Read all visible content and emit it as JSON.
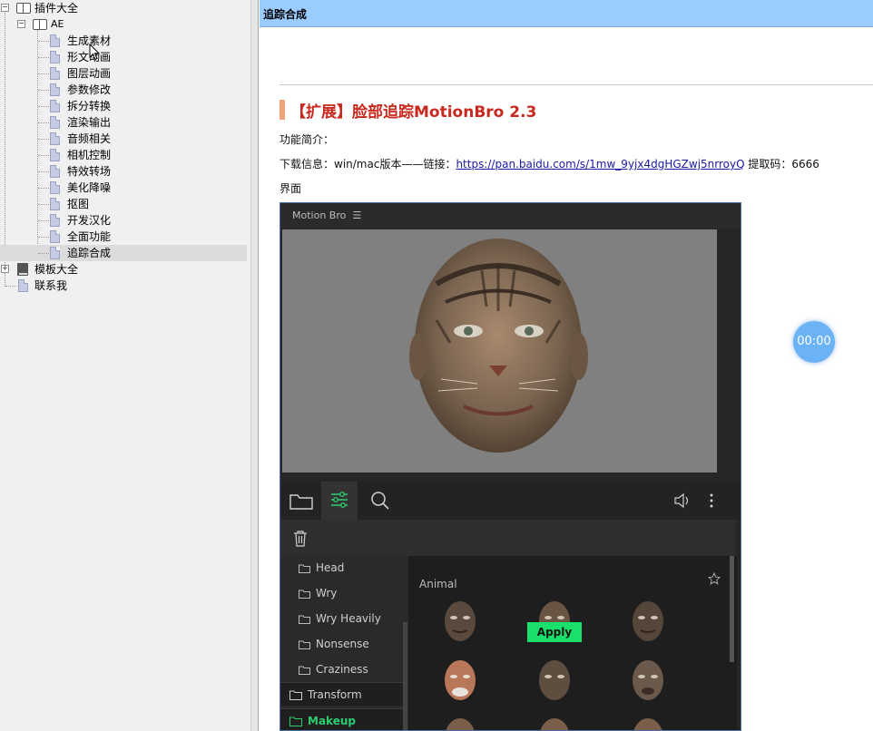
{
  "tree": {
    "root_label": "插件大全",
    "ae_label": "AE",
    "items": [
      "生成素材",
      "形文动画",
      "图层动画",
      "参数修改",
      "拆分转换",
      "渲染输出",
      "音频相关",
      "相机控制",
      "特效转场",
      "美化降噪",
      "抠图",
      "开发汉化",
      "全面功能",
      "追踪合成"
    ],
    "selected": "追踪合成",
    "templates_label": "模板大全",
    "contact_label": "联系我"
  },
  "header": {
    "title": "追踪合成"
  },
  "article": {
    "title": "【扩展】脸部追踪MotionBro 2.3",
    "intro": "功能简介：",
    "download_prefix": "下载信息：win/mac版本——链接：",
    "download_link": "https://pan.baidu.com/s/1mw_9yjx4dgHGZwj5nrroyQ",
    "code_suffix": " 提取码：6666",
    "ui_label": "界面"
  },
  "motionbro": {
    "panel_title": "Motion Bro",
    "subcategories": [
      "Head",
      "Wry",
      "Wry Heavily",
      "Nonsense",
      "Craziness"
    ],
    "categories": [
      "Transform",
      "Makeup"
    ],
    "active_category": "Makeup",
    "grid_title": "Animal",
    "apply_label": "Apply",
    "icons": [
      "folder-icon",
      "sliders-icon",
      "search-icon",
      "volume-icon",
      "more-icon",
      "trash-icon",
      "star-icon"
    ]
  },
  "timer": {
    "value": "00:00"
  },
  "colors": {
    "header_bg": "#99ccff",
    "title_red": "#c8281e",
    "apply_green": "#19e06a",
    "accent_bar": "#f0a47a"
  }
}
